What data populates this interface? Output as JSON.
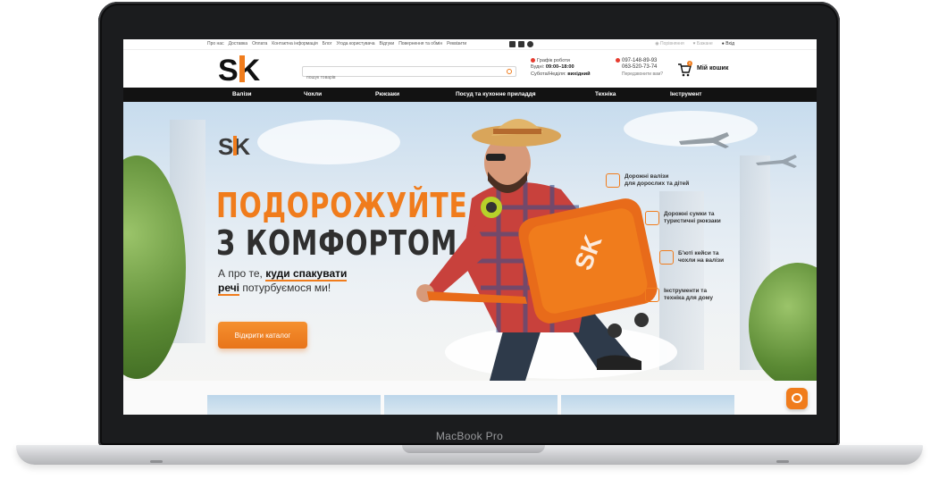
{
  "device": {
    "label": "MacBook Pro"
  },
  "topbar": {
    "links": [
      "Про нас",
      "Доставка",
      "Оплата",
      "Контактна інформація",
      "Блог",
      "Угода користувача",
      "Відгуки",
      "Повернення та обмін",
      "Реквізити"
    ],
    "compare": "Порівняння",
    "wishlist": "Бажане",
    "login": "Вхід"
  },
  "header": {
    "logo_text": "SK",
    "search_placeholder": "пошук товарів",
    "schedule_title": "Графік роботи",
    "weekdays_label": "Будні:",
    "weekdays_hours": "09:00–18:00",
    "weekend_label": "Субота/Неділя:",
    "weekend_hours": "вихідний",
    "phone1": "097-148-89-93",
    "phone2": "063-520-73-74",
    "callback": "Передзвонити вам?",
    "cart_count": "0",
    "cart_label": "Мій кошик"
  },
  "nav": [
    "Валізи",
    "Чохли",
    "Рюкзаки",
    "Посуд та кухонне приладдя",
    "Техніка",
    "Інструмент"
  ],
  "hero": {
    "logo_text": "SK",
    "title_line1": "ПОДОРОЖУЙТЕ",
    "title_line2": "З КОМФОРТОМ",
    "sub_pre": "А про те,",
    "sub_bold1": "куди спакувати",
    "sub_bold2": "речі",
    "sub_post": "потурбуємося ми!",
    "cta": "Відкрити каталог",
    "features": [
      {
        "line1": "Дорожні валізи",
        "line2": "для дорослих та дітей",
        "icon": "suitcase-icon"
      },
      {
        "line1": "Дорожні сумки та",
        "line2": "туристичні рюкзаки",
        "icon": "backpack-icon"
      },
      {
        "line1": "Б'юті кейси та",
        "line2": "чохли на валізи",
        "icon": "case-icon"
      },
      {
        "line1": "Інструменти та",
        "line2": "техніка для дому",
        "icon": "tools-icon"
      }
    ]
  },
  "colors": {
    "accent": "#f07c1c",
    "nav_bg": "#121212",
    "bezel": "#1b1c1e"
  }
}
